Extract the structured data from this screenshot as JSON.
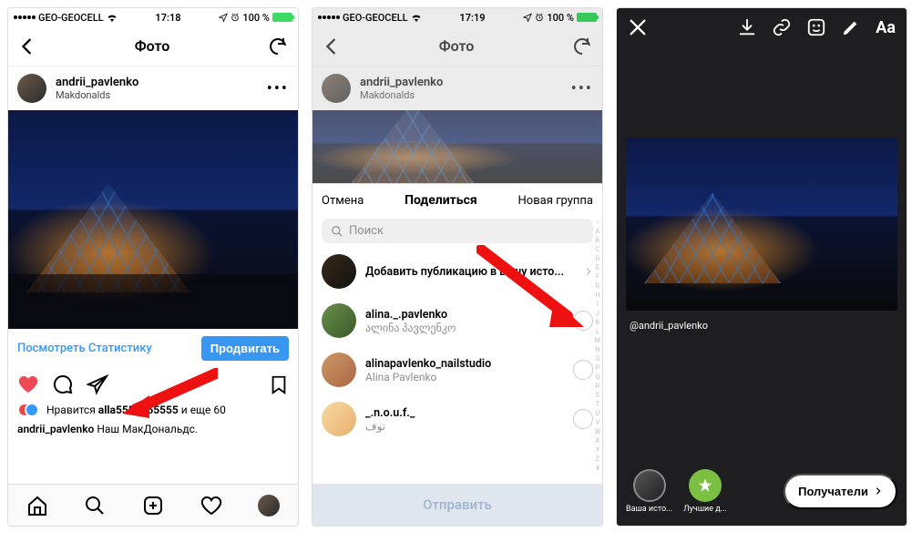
{
  "status": {
    "carrier": "GEO-GEOCELL",
    "wifi": true,
    "time1": "17:18",
    "time2": "17:19",
    "battery_pct": "100 %"
  },
  "screen1": {
    "title": "Фото",
    "author": {
      "username": "andrii_pavlenko",
      "location": "Makdonalds"
    },
    "stats_link": "Посмотреть Статистику",
    "promote": "Продвигать",
    "likes_text_prefix": "Нравится ",
    "likes_user": "alla5555555555",
    "likes_suffix": " и еще 60",
    "caption_user": "andrii_pavlenko",
    "caption_text": " Наш МакДональдс."
  },
  "screen2": {
    "title": "Фото",
    "author": {
      "username": "andrii_pavlenko",
      "location": "Makdonalds"
    },
    "sheet": {
      "cancel": "Отмена",
      "share": "Поделиться",
      "newgroup": "Новая группа",
      "search_placeholder": "Поиск",
      "contacts": [
        {
          "name": "Добавить публикацию в вашу исто...",
          "sub": ""
        },
        {
          "name": "alina._.pavlenko",
          "sub": "ალინა პავლენკო"
        },
        {
          "name": "alinapavlenko_nailstudio",
          "sub": "Alina Pavlenko"
        },
        {
          "name": "_.n.o.u.f._",
          "sub": "نوف"
        }
      ],
      "send": "Отправить",
      "alpha": "☆ A B C D E F G H I J K L M N O P Q R S T U V W X Y Z #"
    }
  },
  "screen3": {
    "mention": "@andrii_pavlenko",
    "bottom": {
      "your_story": "Ваша исто...",
      "best_friends": "Лучшие д...",
      "recipients": "Получатели"
    },
    "text_tool": "Aa"
  }
}
